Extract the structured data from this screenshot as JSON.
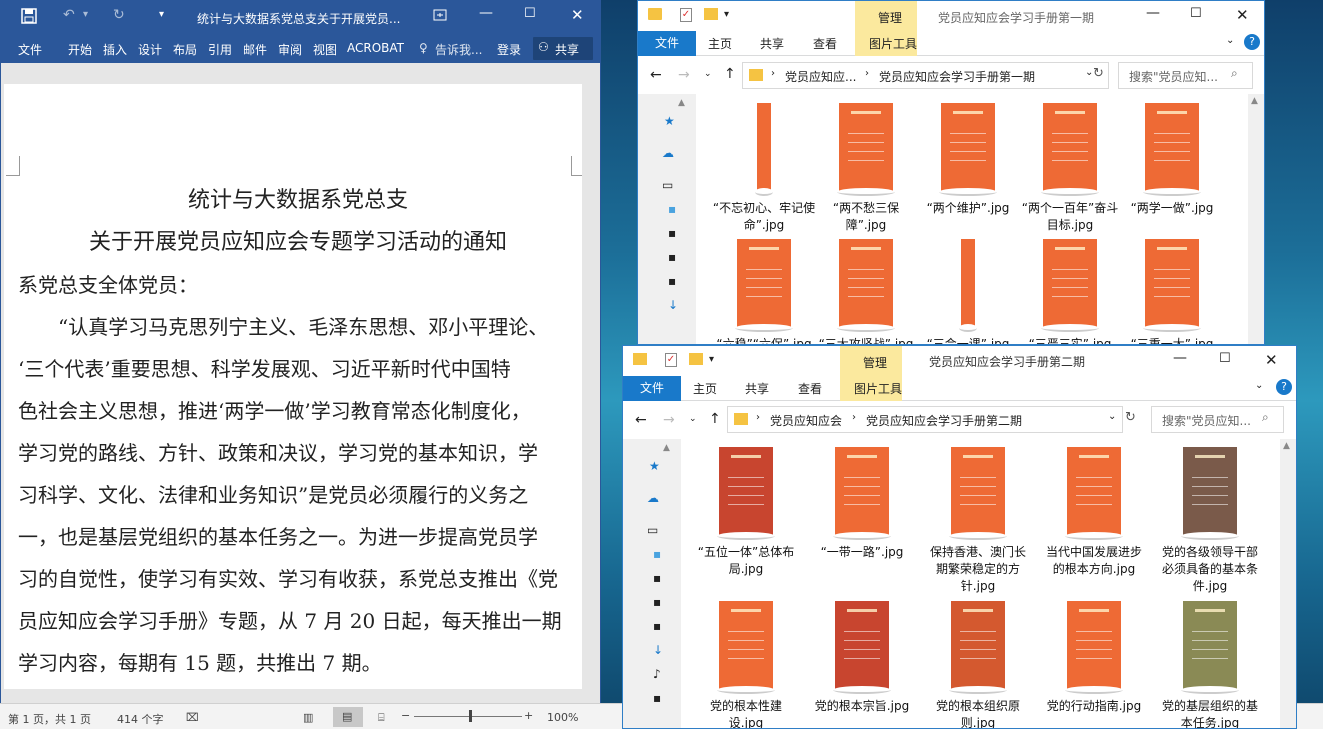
{
  "word": {
    "title": "统计与大数据系党总支关于开展党员...",
    "tabs": [
      "文件",
      "开始",
      "插入",
      "设计",
      "布局",
      "引用",
      "邮件",
      "审阅",
      "视图",
      "ACROBAT"
    ],
    "tell_me": "告诉我...",
    "login": "登录",
    "share": "共享",
    "doc_lines": [
      "统计与大数据系党总支",
      "关于开展党员应知应会专题学习活动的通知",
      "系党总支全体党员：",
      "“认真学习马克思列宁主义、毛泽东思想、邓小平理论、",
      "‘三个代表’重要思想、科学发展观、习近平新时代中国特",
      "色社会主义思想，推进‘两学一做’学习教育常态化制度化，",
      "学习党的路线、方针、政策和决议，学习党的基本知识，学",
      "习科学、文化、法律和业务知识”是党员必须履行的义务之",
      "一，也是基层党组织的基本任务之一。为进一步提高党员学",
      "习的自觉性，使学习有实效、学习有收获，系党总支推出《党",
      "员应知应会学习手册》专题，从 7 月 20 日起，每天推出一期",
      "学习内容，每期有 15 题，共推出 7 期。"
    ],
    "status": {
      "page": "第 1 页，共 1 页",
      "words": "414 个字",
      "zoom": "100%",
      "zoom_level": 1.0
    },
    "colors": {
      "accent": "#2b579a"
    }
  },
  "explorer1": {
    "title": "党员应知应会学习手册第一期",
    "tool_tab": "管理",
    "tabs": [
      "文件",
      "主页",
      "共享",
      "查看",
      "图片工具"
    ],
    "crumbs": [
      "党员应知应...",
      "党员应知应会学习手册第一期"
    ],
    "search_placeholder": "搜索\"党员应知...",
    "files": [
      {
        "name": "“不忘初心、牢记使命”.jpg",
        "color": "#ee6a35",
        "narrow": true
      },
      {
        "name": "“两不愁三保障”.jpg",
        "color": "#ee6a35"
      },
      {
        "name": "“两个维护”.jpg",
        "color": "#ee6a35"
      },
      {
        "name": "“两个一百年”奋斗目标.jpg",
        "color": "#ee6a35"
      },
      {
        "name": "“两学一做”.jpg",
        "color": "#ee6a35"
      },
      {
        "name": "“六稳”“六保”.jpg",
        "color": "#ee6a35"
      },
      {
        "name": "“三大攻坚战”.jpg",
        "color": "#ee6a35"
      },
      {
        "name": "“三会一课”.jpg",
        "color": "#ee6a35",
        "narrow": true
      },
      {
        "name": "“三严三实”.jpg",
        "color": "#ee6a35"
      },
      {
        "name": "“三重一大”.jpg",
        "color": "#ee6a35"
      }
    ]
  },
  "explorer2": {
    "title": "党员应知应会学习手册第二期",
    "tool_tab": "管理",
    "tabs": [
      "文件",
      "主页",
      "共享",
      "查看",
      "图片工具"
    ],
    "crumbs": [
      "党员应知应会",
      "党员应知应会学习手册第二期"
    ],
    "search_placeholder": "搜索\"党员应知...",
    "files": [
      {
        "name": "“五位一体”总体布局.jpg",
        "color": "#c8452f"
      },
      {
        "name": "“一带一路”.jpg",
        "color": "#ee6a35"
      },
      {
        "name": "保持香港、澳门长期繁荣稳定的方针.jpg",
        "color": "#ee6a35"
      },
      {
        "name": "当代中国发展进步的根本方向.jpg",
        "color": "#ee6a35"
      },
      {
        "name": "党的各级领导干部必须具备的基本条件.jpg",
        "color": "#7a5a4a"
      },
      {
        "name": "党的根本性建设.jpg",
        "color": "#ee6a35"
      },
      {
        "name": "党的根本宗旨.jpg",
        "color": "#c8452f"
      },
      {
        "name": "党的根本组织原则.jpg",
        "color": "#d4592f"
      },
      {
        "name": "党的行动指南.jpg",
        "color": "#ee6a35"
      },
      {
        "name": "党的基层组织的基本任务.jpg",
        "color": "#8a8a55"
      }
    ]
  }
}
